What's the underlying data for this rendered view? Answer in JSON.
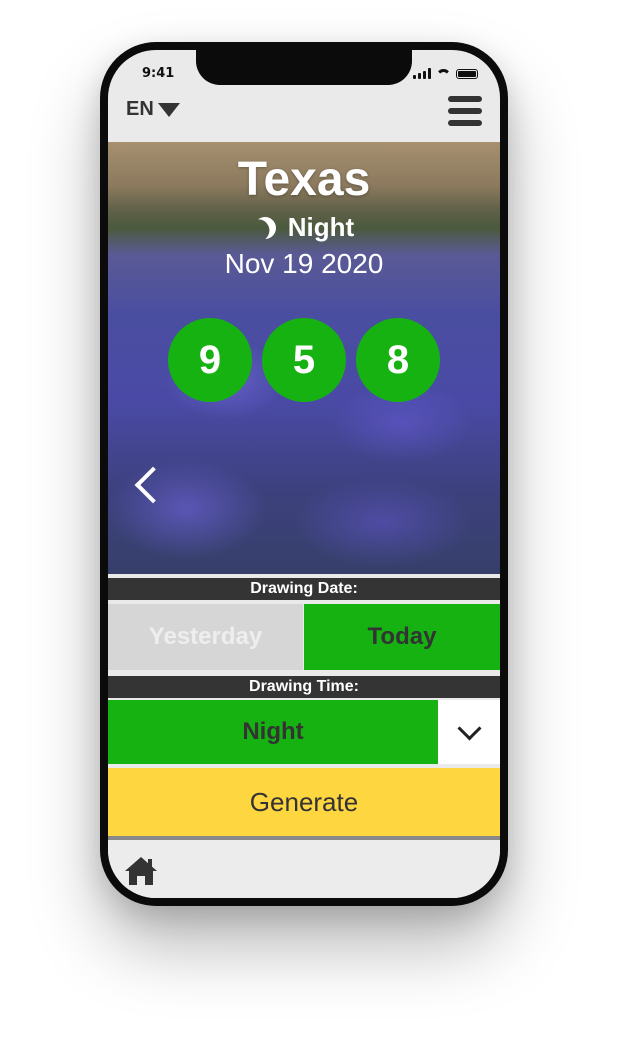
{
  "status": {
    "time": "9:41"
  },
  "header": {
    "language": "EN"
  },
  "hero": {
    "state": "Texas",
    "draw_time": "Night",
    "draw_date": "Nov 19 2020",
    "numbers": [
      "9",
      "5",
      "8"
    ],
    "ball_color": "#16b211"
  },
  "drawing_date": {
    "label": "Drawing Date:",
    "options": [
      "Yesterday",
      "Today"
    ],
    "selected": "Today"
  },
  "drawing_time": {
    "label": "Drawing Time:",
    "selected": "Night"
  },
  "actions": {
    "generate_label": "Generate"
  },
  "colors": {
    "accent_green": "#16b211",
    "generate_yellow": "#fed640",
    "section_bar": "#343434"
  },
  "icons": [
    "moon-icon",
    "chevron-left-icon",
    "chevron-down-icon",
    "home-icon",
    "hamburger-menu-icon",
    "dropdown-triangle-icon"
  ]
}
